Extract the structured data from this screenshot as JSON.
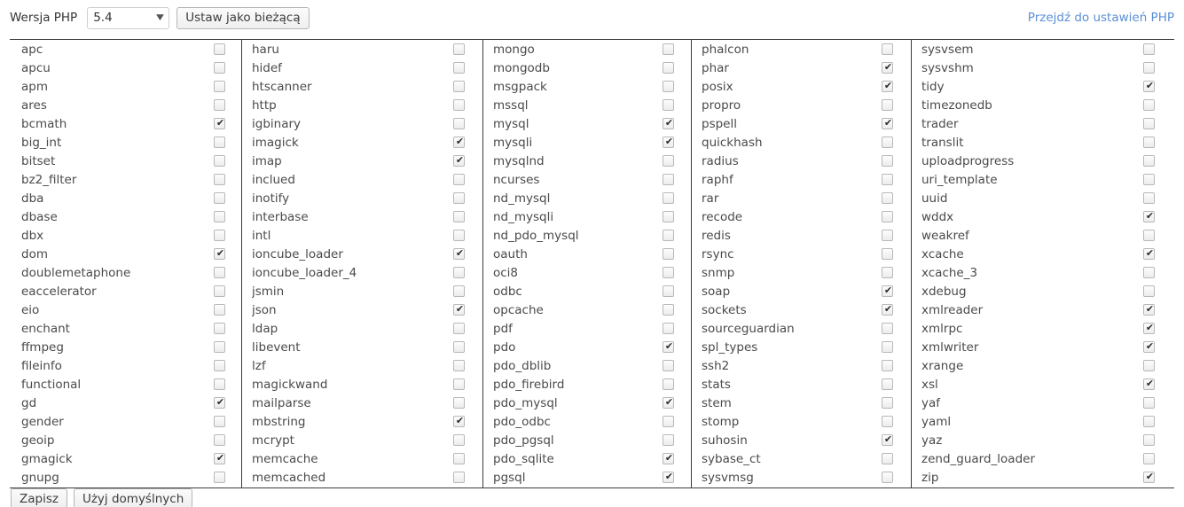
{
  "header": {
    "version_label": "Wersja PHP",
    "selected_version": "5.4",
    "version_options": [
      "5.4"
    ],
    "set_current_label": "Ustaw jako bieżącą",
    "php_settings_link": "Przejdź do ustawień PHP",
    "link_color": "#5a8fd6"
  },
  "footer": {
    "save_label": "Zapisz",
    "defaults_label": "Użyj domyślnych"
  },
  "extensions": {
    "columns": [
      {
        "index": 0,
        "items": [
          {
            "name": "apc",
            "checked": false
          },
          {
            "name": "apcu",
            "checked": false
          },
          {
            "name": "apm",
            "checked": false
          },
          {
            "name": "ares",
            "checked": false
          },
          {
            "name": "bcmath",
            "checked": true
          },
          {
            "name": "big_int",
            "checked": false
          },
          {
            "name": "bitset",
            "checked": false
          },
          {
            "name": "bz2_filter",
            "checked": false
          },
          {
            "name": "dba",
            "checked": false
          },
          {
            "name": "dbase",
            "checked": false
          },
          {
            "name": "dbx",
            "checked": false
          },
          {
            "name": "dom",
            "checked": true
          },
          {
            "name": "doublemetaphone",
            "checked": false
          },
          {
            "name": "eaccelerator",
            "checked": false
          },
          {
            "name": "eio",
            "checked": false
          },
          {
            "name": "enchant",
            "checked": false
          },
          {
            "name": "ffmpeg",
            "checked": false
          },
          {
            "name": "fileinfo",
            "checked": false
          },
          {
            "name": "functional",
            "checked": false
          },
          {
            "name": "gd",
            "checked": true
          },
          {
            "name": "gender",
            "checked": false
          },
          {
            "name": "geoip",
            "checked": false
          },
          {
            "name": "gmagick",
            "checked": true
          },
          {
            "name": "gnupg",
            "checked": false
          }
        ]
      },
      {
        "index": 1,
        "items": [
          {
            "name": "haru",
            "checked": false
          },
          {
            "name": "hidef",
            "checked": false
          },
          {
            "name": "htscanner",
            "checked": false
          },
          {
            "name": "http",
            "checked": false
          },
          {
            "name": "igbinary",
            "checked": false
          },
          {
            "name": "imagick",
            "checked": true
          },
          {
            "name": "imap",
            "checked": true
          },
          {
            "name": "inclued",
            "checked": false
          },
          {
            "name": "inotify",
            "checked": false
          },
          {
            "name": "interbase",
            "checked": false
          },
          {
            "name": "intl",
            "checked": false
          },
          {
            "name": "ioncube_loader",
            "checked": true
          },
          {
            "name": "ioncube_loader_4",
            "checked": false
          },
          {
            "name": "jsmin",
            "checked": false
          },
          {
            "name": "json",
            "checked": true
          },
          {
            "name": "ldap",
            "checked": false
          },
          {
            "name": "libevent",
            "checked": false
          },
          {
            "name": "lzf",
            "checked": false
          },
          {
            "name": "magickwand",
            "checked": false
          },
          {
            "name": "mailparse",
            "checked": false
          },
          {
            "name": "mbstring",
            "checked": true
          },
          {
            "name": "mcrypt",
            "checked": false
          },
          {
            "name": "memcache",
            "checked": false
          },
          {
            "name": "memcached",
            "checked": false
          }
        ]
      },
      {
        "index": 2,
        "items": [
          {
            "name": "mongo",
            "checked": false
          },
          {
            "name": "mongodb",
            "checked": false
          },
          {
            "name": "msgpack",
            "checked": false
          },
          {
            "name": "mssql",
            "checked": false
          },
          {
            "name": "mysql",
            "checked": true
          },
          {
            "name": "mysqli",
            "checked": true
          },
          {
            "name": "mysqlnd",
            "checked": false
          },
          {
            "name": "ncurses",
            "checked": false
          },
          {
            "name": "nd_mysql",
            "checked": false
          },
          {
            "name": "nd_mysqli",
            "checked": false
          },
          {
            "name": "nd_pdo_mysql",
            "checked": false
          },
          {
            "name": "oauth",
            "checked": false
          },
          {
            "name": "oci8",
            "checked": false
          },
          {
            "name": "odbc",
            "checked": false
          },
          {
            "name": "opcache",
            "checked": false
          },
          {
            "name": "pdf",
            "checked": false
          },
          {
            "name": "pdo",
            "checked": true
          },
          {
            "name": "pdo_dblib",
            "checked": false
          },
          {
            "name": "pdo_firebird",
            "checked": false
          },
          {
            "name": "pdo_mysql",
            "checked": true
          },
          {
            "name": "pdo_odbc",
            "checked": false
          },
          {
            "name": "pdo_pgsql",
            "checked": false
          },
          {
            "name": "pdo_sqlite",
            "checked": true
          },
          {
            "name": "pgsql",
            "checked": true
          }
        ]
      },
      {
        "index": 3,
        "items": [
          {
            "name": "phalcon",
            "checked": false
          },
          {
            "name": "phar",
            "checked": true
          },
          {
            "name": "posix",
            "checked": true
          },
          {
            "name": "propro",
            "checked": false
          },
          {
            "name": "pspell",
            "checked": true
          },
          {
            "name": "quickhash",
            "checked": false
          },
          {
            "name": "radius",
            "checked": false
          },
          {
            "name": "raphf",
            "checked": false
          },
          {
            "name": "rar",
            "checked": false
          },
          {
            "name": "recode",
            "checked": false
          },
          {
            "name": "redis",
            "checked": false
          },
          {
            "name": "rsync",
            "checked": false
          },
          {
            "name": "snmp",
            "checked": false
          },
          {
            "name": "soap",
            "checked": true
          },
          {
            "name": "sockets",
            "checked": true
          },
          {
            "name": "sourceguardian",
            "checked": false
          },
          {
            "name": "spl_types",
            "checked": false
          },
          {
            "name": "ssh2",
            "checked": false
          },
          {
            "name": "stats",
            "checked": false
          },
          {
            "name": "stem",
            "checked": false
          },
          {
            "name": "stomp",
            "checked": false
          },
          {
            "name": "suhosin",
            "checked": true
          },
          {
            "name": "sybase_ct",
            "checked": false
          },
          {
            "name": "sysvmsg",
            "checked": false
          }
        ]
      },
      {
        "index": 4,
        "items": [
          {
            "name": "sysvsem",
            "checked": false
          },
          {
            "name": "sysvshm",
            "checked": false
          },
          {
            "name": "tidy",
            "checked": true
          },
          {
            "name": "timezonedb",
            "checked": false
          },
          {
            "name": "trader",
            "checked": false
          },
          {
            "name": "translit",
            "checked": false
          },
          {
            "name": "uploadprogress",
            "checked": false
          },
          {
            "name": "uri_template",
            "checked": false
          },
          {
            "name": "uuid",
            "checked": false
          },
          {
            "name": "wddx",
            "checked": true
          },
          {
            "name": "weakref",
            "checked": false
          },
          {
            "name": "xcache",
            "checked": true
          },
          {
            "name": "xcache_3",
            "checked": false
          },
          {
            "name": "xdebug",
            "checked": false
          },
          {
            "name": "xmlreader",
            "checked": true
          },
          {
            "name": "xmlrpc",
            "checked": true
          },
          {
            "name": "xmlwriter",
            "checked": true
          },
          {
            "name": "xrange",
            "checked": false
          },
          {
            "name": "xsl",
            "checked": true
          },
          {
            "name": "yaf",
            "checked": false
          },
          {
            "name": "yaml",
            "checked": false
          },
          {
            "name": "yaz",
            "checked": false
          },
          {
            "name": "zend_guard_loader",
            "checked": false
          },
          {
            "name": "zip",
            "checked": true
          }
        ]
      }
    ]
  }
}
